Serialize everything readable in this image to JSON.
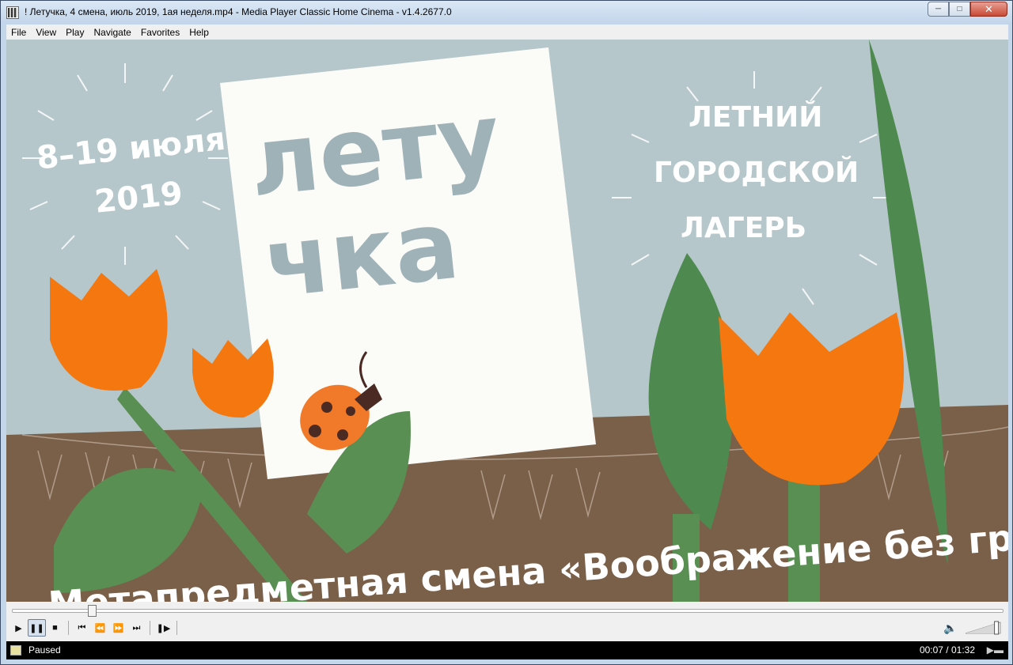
{
  "window": {
    "title": "! Летучка, 4 смена, июль 2019, 1ая неделя.mp4 - Media Player Classic Home Cinema - v1.4.2677.0",
    "minimize_icon": "minimize-icon",
    "maximize_icon": "maximize-icon",
    "close_icon": "close-icon"
  },
  "menu": [
    "File",
    "View",
    "Play",
    "Navigate",
    "Favorites",
    "Help"
  ],
  "video": {
    "dates_line1": "8–19 июля",
    "dates_line2": "2019",
    "logo_line1": "лету",
    "logo_line2": "чка",
    "camp_line1": "ЛЕТНИЙ",
    "camp_line2": "ГОРОДСКОЙ",
    "camp_line3": "ЛАГЕРЬ",
    "caption": "Метапредметная смена «Воображение без границ!»"
  },
  "seek": {
    "position": 0.081
  },
  "controls": {
    "icons": [
      "play-icon",
      "pause-icon",
      "stop-icon",
      "skip-back-icon",
      "rewind-icon",
      "fast-forward-icon",
      "skip-forward-icon",
      "frame-step-icon"
    ],
    "volume_icon": "speaker-icon",
    "volume_level": 0.9
  },
  "status": {
    "state": "Paused",
    "time": "00:07 / 01:32"
  }
}
